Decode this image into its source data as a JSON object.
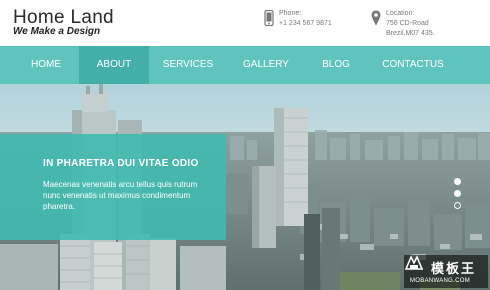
{
  "brand": {
    "title": "Home Land",
    "tagline": "We Make a Design"
  },
  "contact": {
    "phone_label": "Phone:",
    "phone_value": "+1 234 567 9871",
    "location_label": "Location:",
    "location_line1": "756 CD-Road",
    "location_line2": "Brezil.M07 435.",
    "phone_icon": "phone-icon",
    "location_icon": "map-pin-icon"
  },
  "nav": {
    "items": [
      {
        "label": "HOME",
        "active": false
      },
      {
        "label": "ABOUT",
        "active": true
      },
      {
        "label": "SERVICES",
        "active": false
      },
      {
        "label": "GALLERY",
        "active": false
      },
      {
        "label": "BLOG",
        "active": false
      },
      {
        "label": "CONTACTUS",
        "active": false
      }
    ]
  },
  "hero": {
    "caption_title": "IN PHARETRA DUI VITAE ODIO",
    "caption_text": "Maecenas venenatis arcu tellus quis rutrum nunc venenatis ut maximus condimentum pharetra.",
    "slides_count": 3,
    "active_slide": 1
  },
  "watermark": {
    "chinese": "模板王",
    "url": "MOBANWANG.COM"
  },
  "colors": {
    "nav_bg": "#5fc4bd",
    "nav_active": "#43afa8",
    "caption_bg": "#40bab0"
  }
}
